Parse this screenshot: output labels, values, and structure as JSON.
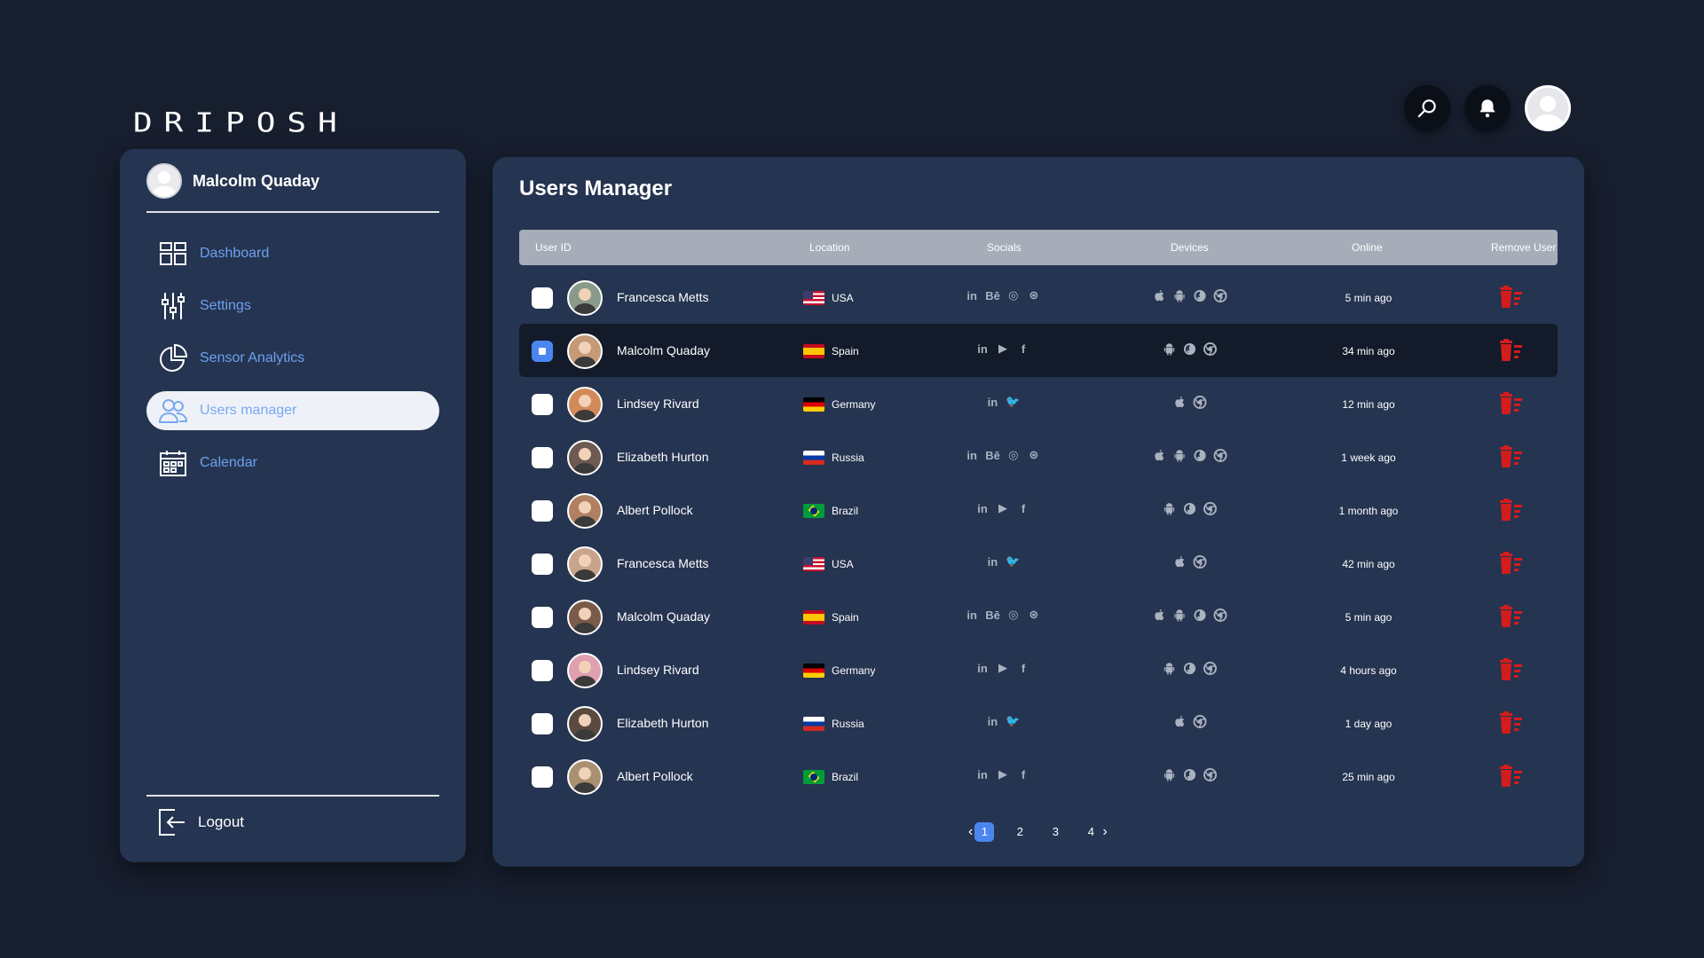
{
  "brand": {
    "logo": "DRIPOSH"
  },
  "header": {
    "search_icon": "search-icon",
    "bell_icon": "bell-icon"
  },
  "sidebar": {
    "user_name": "Malcolm Quaday",
    "items": [
      {
        "label": "Dashboard",
        "icon": "dashboard-icon",
        "active": false
      },
      {
        "label": "Settings",
        "icon": "sliders-icon",
        "active": false
      },
      {
        "label": "Sensor Analytics",
        "icon": "pie-chart-icon",
        "active": false
      },
      {
        "label": "Users manager",
        "icon": "users-icon",
        "active": true
      },
      {
        "label": "Calendar",
        "icon": "calendar-icon",
        "active": false
      }
    ],
    "logout_label": "Logout"
  },
  "main": {
    "title": "Users Manager",
    "columns": {
      "user_id": "User ID",
      "location": "Location",
      "socials": "Socials",
      "devices": "Devices",
      "online": "Online",
      "remove": "Remove User"
    },
    "colors": {
      "accent": "#4b86f0",
      "delete": "#d31c1c",
      "panel": "#253450",
      "background": "#171e2e"
    },
    "rows": [
      {
        "name": "Francesca Metts",
        "location": "USA",
        "socials": [
          "linkedin",
          "behance",
          "instagram",
          "dribbble"
        ],
        "devices": [
          "apple",
          "android",
          "firefox",
          "chrome"
        ],
        "online": "5 min ago",
        "checked": false,
        "selected": false
      },
      {
        "name": "Malcolm Quaday",
        "location": "Spain",
        "socials": [
          "linkedin",
          "youtube",
          "facebook"
        ],
        "devices": [
          "android",
          "firefox",
          "chrome"
        ],
        "online": "34 min ago",
        "checked": true,
        "selected": true
      },
      {
        "name": "Lindsey Rivard",
        "location": "Germany",
        "socials": [
          "linkedin",
          "twitter"
        ],
        "devices": [
          "apple",
          "chrome"
        ],
        "online": "12 min ago",
        "checked": false,
        "selected": false
      },
      {
        "name": "Elizabeth Hurton",
        "location": "Russia",
        "socials": [
          "linkedin",
          "behance",
          "instagram",
          "dribbble"
        ],
        "devices": [
          "apple",
          "android",
          "firefox",
          "chrome"
        ],
        "online": "1 week ago",
        "checked": false,
        "selected": false
      },
      {
        "name": "Albert Pollock",
        "location": "Brazil",
        "socials": [
          "linkedin",
          "youtube",
          "facebook"
        ],
        "devices": [
          "android",
          "firefox",
          "chrome"
        ],
        "online": "1 month ago",
        "checked": false,
        "selected": false
      },
      {
        "name": "Francesca Metts",
        "location": "USA",
        "socials": [
          "linkedin",
          "twitter"
        ],
        "devices": [
          "apple",
          "chrome"
        ],
        "online": "42 min ago",
        "checked": false,
        "selected": false
      },
      {
        "name": "Malcolm Quaday",
        "location": "Spain",
        "socials": [
          "linkedin",
          "behance",
          "instagram",
          "dribbble"
        ],
        "devices": [
          "apple",
          "android",
          "firefox",
          "chrome"
        ],
        "online": "5 min ago",
        "checked": false,
        "selected": false
      },
      {
        "name": "Lindsey Rivard",
        "location": "Germany",
        "socials": [
          "linkedin",
          "youtube",
          "facebook"
        ],
        "devices": [
          "android",
          "firefox",
          "chrome"
        ],
        "online": "4 hours ago",
        "checked": false,
        "selected": false
      },
      {
        "name": "Elizabeth Hurton",
        "location": "Russia",
        "socials": [
          "linkedin",
          "twitter"
        ],
        "devices": [
          "apple",
          "chrome"
        ],
        "online": "1 day ago",
        "checked": false,
        "selected": false
      },
      {
        "name": "Albert Pollock",
        "location": "Brazil",
        "socials": [
          "linkedin",
          "youtube",
          "facebook"
        ],
        "devices": [
          "android",
          "firefox",
          "chrome"
        ],
        "online": "25 min ago",
        "checked": false,
        "selected": false
      }
    ]
  },
  "pagination": {
    "pages": [
      "1",
      "2",
      "3",
      "4"
    ],
    "current": "1",
    "prev": "‹",
    "next": "›"
  }
}
